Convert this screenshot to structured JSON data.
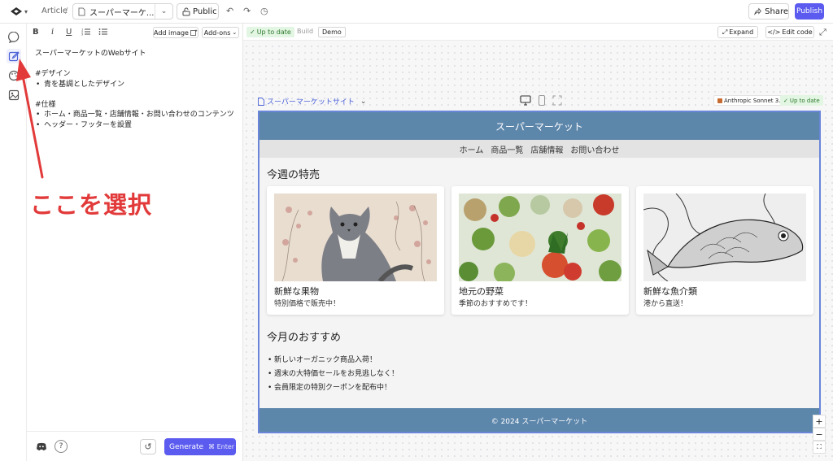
{
  "topbar": {
    "breadcrumb_article": "Article",
    "breadcrumb_sep": "/",
    "doc_name": "スーパーマーケ...",
    "visibility": "Public",
    "share_label": "Share",
    "publish_label": "Publish"
  },
  "editor": {
    "toolbar": {
      "bold": "B",
      "italic": "i",
      "underline": "U"
    },
    "add_image_label": "Add image",
    "addons_label": "Add-ons",
    "prompt": {
      "title": "スーパーマーケットのWebサイト",
      "design_heading": "#デザイン",
      "design_items": [
        "青を基調としたデザイン"
      ],
      "spec_heading": "#仕様",
      "spec_items": [
        "ホーム・商品一覧・店舗情報・お問い合わせのコンテンツ",
        "ヘッダー・フッターを設置"
      ]
    },
    "help_label": "?",
    "generate_label": "Generate",
    "generate_shortcut": "⌘ Enter"
  },
  "annotation": {
    "text": "ここを選択",
    "color": "#e23a3a"
  },
  "preview": {
    "status": "Up to date",
    "build_label": "Build",
    "demo_label": "Demo",
    "expand_label": "Expand",
    "edit_code_label": "Edit code",
    "site_selector": "スーパーマーケットサイト",
    "model_name": "Anthropic Sonnet 3.5",
    "model_status": "Up to date",
    "zoom_in": "+",
    "zoom_out": "−"
  },
  "site": {
    "header_title": "スーパーマーケット",
    "header_color": "#5d86ab",
    "nav": [
      "ホーム",
      "商品一覧",
      "店舗情報",
      "お問い合わせ"
    ],
    "weekly_title": "今週の特売",
    "cards": [
      {
        "title": "新鮮な果物",
        "desc": "特別価格で販売中！"
      },
      {
        "title": "地元の野菜",
        "desc": "季節のおすすめです！"
      },
      {
        "title": "新鮮な魚介類",
        "desc": "港から直送！"
      }
    ],
    "monthly_title": "今月のおすすめ",
    "recommendations": [
      "新しいオーガニック商品入荷！",
      "週末の大特価セールをお見逃しなく！",
      "会員限定の特別クーポンを配布中！"
    ],
    "footer": "© 2024 スーパーマーケット"
  },
  "colors": {
    "accent": "#5b5bf0",
    "link": "#4a60d6",
    "success_bg": "#e3f5e3"
  }
}
